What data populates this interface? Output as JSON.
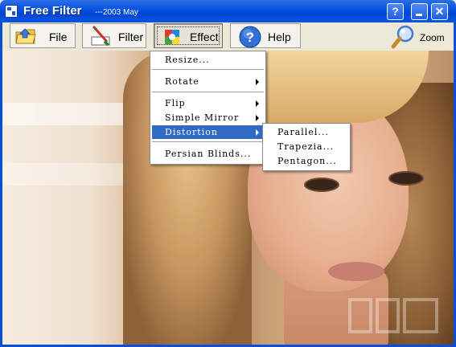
{
  "window": {
    "title": "Free Filter",
    "subtitle": "---2003 May",
    "controls": {
      "help": "?",
      "minimize": "minimize",
      "close": "✕"
    }
  },
  "toolbar": {
    "file_label": "File",
    "filter_label": "Filter",
    "effect_label": "Effect",
    "help_label": "Help",
    "zoom_label": "Zoom",
    "icons": {
      "file": "folder-icon",
      "filter": "brush-icon",
      "effect": "palette-icon",
      "help": "help-circle-icon",
      "zoom": "magnifier-icon"
    }
  },
  "effect_menu": {
    "items": [
      {
        "label": "Resize...",
        "submenu": false
      },
      {
        "label": "Rotate",
        "submenu": true
      },
      {
        "label": "Flip",
        "submenu": true
      },
      {
        "label": "Simple Mirror",
        "submenu": true
      },
      {
        "label": "Distortion",
        "submenu": true,
        "highlighted": true
      },
      {
        "label": "Persian Blinds...",
        "submenu": false
      }
    ]
  },
  "distortion_menu": {
    "items": [
      {
        "label": "Parallel..."
      },
      {
        "label": "Trapezia..."
      },
      {
        "label": "Pentagon..."
      }
    ]
  },
  "colors": {
    "titlebar": "#0a57e4",
    "highlight": "#316ac5",
    "toolbar_bg": "#ece9d8"
  }
}
